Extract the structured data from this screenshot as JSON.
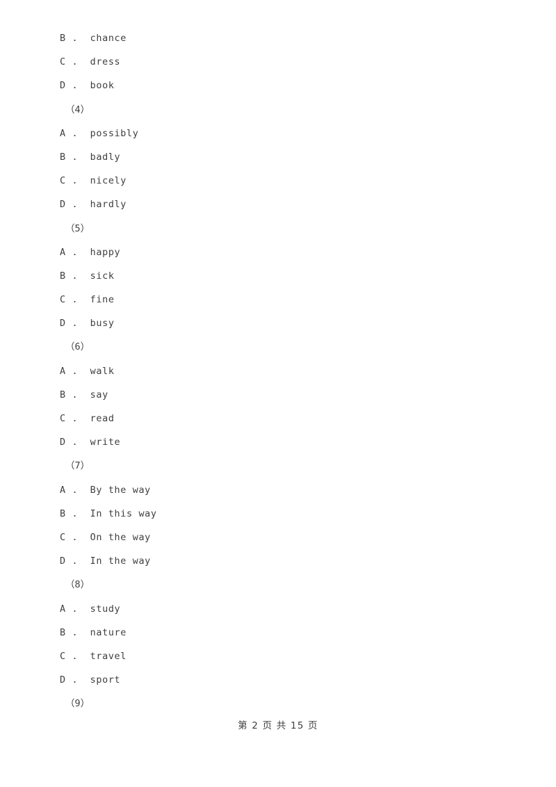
{
  "document": {
    "type": "exam-paper",
    "language": "zh-CN",
    "background_color": "#ffffff",
    "text_color": "#3f3f3f"
  },
  "blocks": [
    {
      "kind": "option",
      "label": "B",
      "separator": ".",
      "text": "chance",
      "display": "B .  chance"
    },
    {
      "kind": "option",
      "label": "C",
      "separator": ".",
      "text": "dress",
      "display": "C .  dress"
    },
    {
      "kind": "option",
      "label": "D",
      "separator": ".",
      "text": "book",
      "display": "D .  book"
    },
    {
      "kind": "question-number",
      "number": "4",
      "display": "（4）"
    },
    {
      "kind": "option",
      "label": "A",
      "separator": ".",
      "text": "possibly",
      "display": "A .  possibly"
    },
    {
      "kind": "option",
      "label": "B",
      "separator": ".",
      "text": "badly",
      "display": "B .  badly"
    },
    {
      "kind": "option",
      "label": "C",
      "separator": ".",
      "text": "nicely",
      "display": "C .  nicely"
    },
    {
      "kind": "option",
      "label": "D",
      "separator": ".",
      "text": "hardly",
      "display": "D .  hardly"
    },
    {
      "kind": "question-number",
      "number": "5",
      "display": "（5）"
    },
    {
      "kind": "option",
      "label": "A",
      "separator": ".",
      "text": "happy",
      "display": "A .  happy"
    },
    {
      "kind": "option",
      "label": "B",
      "separator": ".",
      "text": "sick",
      "display": "B .  sick"
    },
    {
      "kind": "option",
      "label": "C",
      "separator": ".",
      "text": "fine",
      "display": "C .  fine"
    },
    {
      "kind": "option",
      "label": "D",
      "separator": ".",
      "text": "busy",
      "display": "D .  busy"
    },
    {
      "kind": "question-number",
      "number": "6",
      "display": "（6）"
    },
    {
      "kind": "option",
      "label": "A",
      "separator": ".",
      "text": "walk",
      "display": "A .  walk"
    },
    {
      "kind": "option",
      "label": "B",
      "separator": ".",
      "text": "say",
      "display": "B .  say"
    },
    {
      "kind": "option",
      "label": "C",
      "separator": ".",
      "text": "read",
      "display": "C .  read"
    },
    {
      "kind": "option",
      "label": "D",
      "separator": ".",
      "text": "write",
      "display": "D .  write"
    },
    {
      "kind": "question-number",
      "number": "7",
      "display": "（7）"
    },
    {
      "kind": "option",
      "label": "A",
      "separator": ".",
      "text": "By the way",
      "display": "A .  By the way"
    },
    {
      "kind": "option",
      "label": "B",
      "separator": ".",
      "text": "In this way",
      "display": "B .  In this way"
    },
    {
      "kind": "option",
      "label": "C",
      "separator": ".",
      "text": "On the way",
      "display": "C .  On the way"
    },
    {
      "kind": "option",
      "label": "D",
      "separator": ".",
      "text": "In the way",
      "display": "D .  In the way"
    },
    {
      "kind": "question-number",
      "number": "8",
      "display": "（8）"
    },
    {
      "kind": "option",
      "label": "A",
      "separator": ".",
      "text": "study",
      "display": "A .  study"
    },
    {
      "kind": "option",
      "label": "B",
      "separator": ".",
      "text": "nature",
      "display": "B .  nature"
    },
    {
      "kind": "option",
      "label": "C",
      "separator": ".",
      "text": "travel",
      "display": "C .  travel"
    },
    {
      "kind": "option",
      "label": "D",
      "separator": ".",
      "text": "sport",
      "display": "D .  sport"
    },
    {
      "kind": "question-number",
      "number": "9",
      "display": "（9）"
    }
  ],
  "footer": {
    "current_page": "2",
    "total_pages": "15",
    "display": "第 2 页 共 15 页"
  }
}
